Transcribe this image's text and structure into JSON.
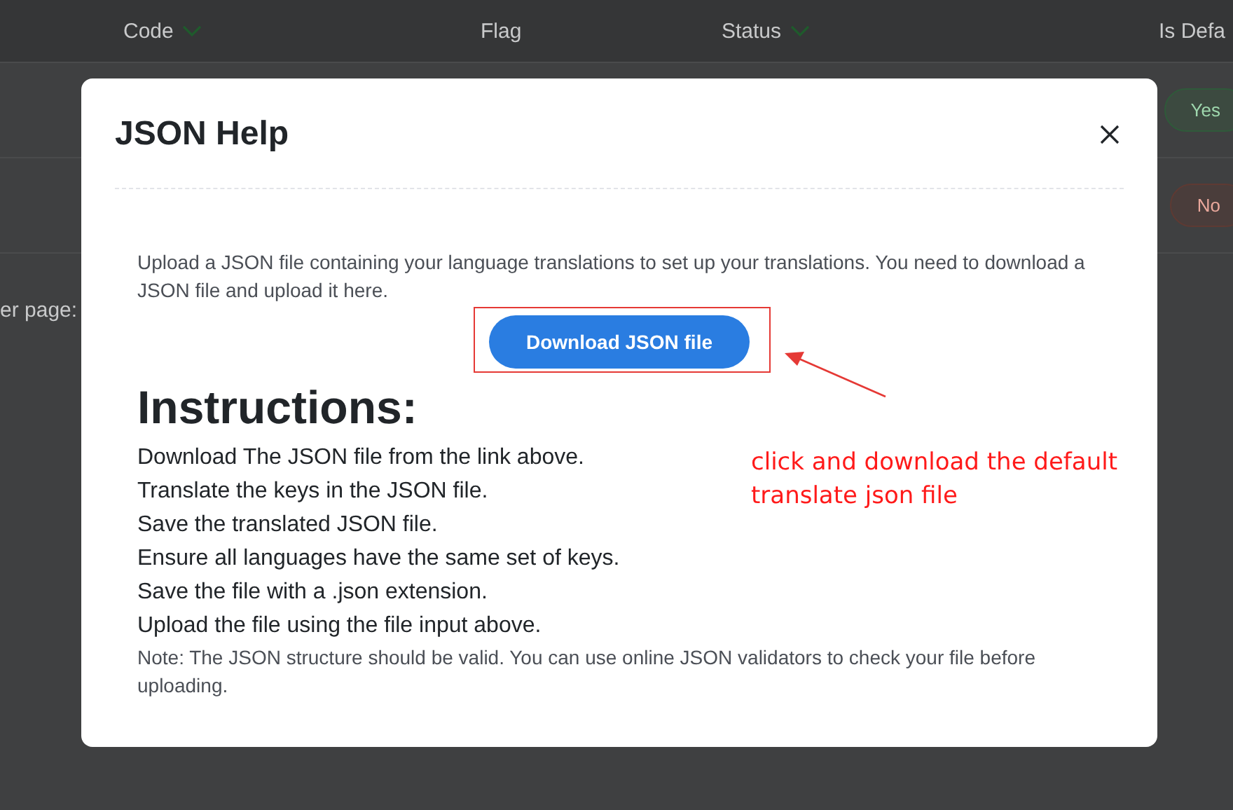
{
  "background_table": {
    "columns": [
      {
        "label": "Code",
        "sortable": true
      },
      {
        "label": "Flag",
        "sortable": false
      },
      {
        "label": "Status",
        "sortable": true
      },
      {
        "label": "Is Defa",
        "sortable": false
      }
    ],
    "rows": [
      {
        "badge": "Yes",
        "kind": "yes"
      },
      {
        "badge": "No",
        "kind": "no"
      }
    ],
    "per_page_label": "er page:"
  },
  "modal": {
    "title": "JSON Help",
    "intro": "Upload a JSON file containing your language translations to set up your translations. You need to download a JSON file and upload it here.",
    "download_button": "Download JSON file",
    "instructions_heading": "Instructions:",
    "steps": [
      "Download The JSON file from the link above.",
      "Translate the keys in the JSON file.",
      "Save the translated JSON file.",
      "Ensure all languages have the same set of keys.",
      "Save the file with a .json extension.",
      "Upload the file using the file input above."
    ],
    "note": "Note: The JSON structure should be valid. You can use online JSON validators to check your file before uploading."
  },
  "annotation": {
    "text": "click and download the default translate json file"
  }
}
